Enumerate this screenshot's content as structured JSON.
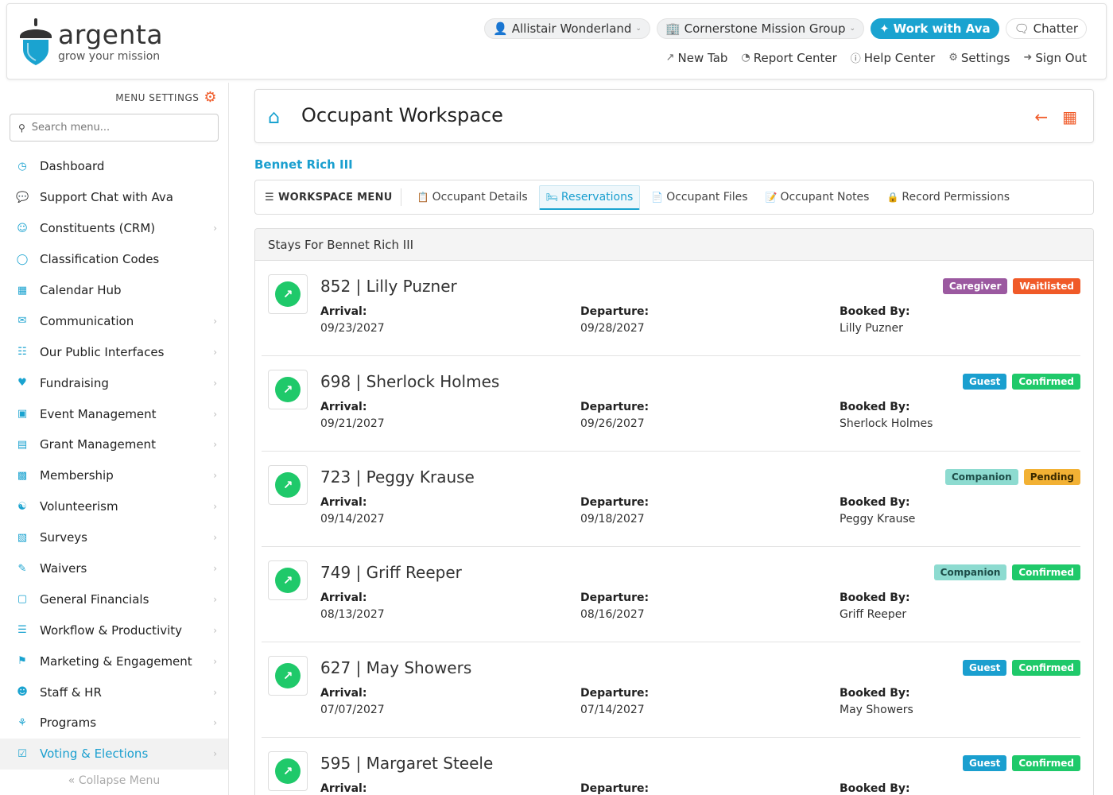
{
  "header": {
    "brand": "argenta",
    "tagline": "grow your mission",
    "user": "Allistair Wonderland",
    "org": "Cornerstone Mission Group",
    "ava_button": "Work with Ava",
    "chatter": "Chatter",
    "links": [
      {
        "label": "New Tab",
        "icon": "external-link-icon"
      },
      {
        "label": "Report Center",
        "icon": "chart-icon"
      },
      {
        "label": "Help Center",
        "icon": "help-icon"
      },
      {
        "label": "Settings",
        "icon": "gear-icon"
      },
      {
        "label": "Sign Out",
        "icon": "sign-out-icon"
      }
    ]
  },
  "sidebar": {
    "menu_settings": "MENU SETTINGS",
    "search_placeholder": "Search menu...",
    "items": [
      {
        "label": "Dashboard",
        "icon": "dashboard-icon"
      },
      {
        "label": "Support Chat with Ava",
        "icon": "chat-icon"
      },
      {
        "label": "Constituents (CRM)",
        "icon": "people-icon"
      },
      {
        "label": "Classification Codes",
        "icon": "tag-icon"
      },
      {
        "label": "Calendar Hub",
        "icon": "calendar-icon"
      },
      {
        "label": "Communication",
        "icon": "mail-icon"
      },
      {
        "label": "Our Public Interfaces",
        "icon": "globe-icon"
      },
      {
        "label": "Fundraising",
        "icon": "donation-icon"
      },
      {
        "label": "Event Management",
        "icon": "event-icon"
      },
      {
        "label": "Grant Management",
        "icon": "grant-icon"
      },
      {
        "label": "Membership",
        "icon": "id-card-icon"
      },
      {
        "label": "Volunteerism",
        "icon": "volunteer-icon"
      },
      {
        "label": "Surveys",
        "icon": "survey-icon"
      },
      {
        "label": "Waivers",
        "icon": "waiver-icon"
      },
      {
        "label": "General Financials",
        "icon": "money-icon"
      },
      {
        "label": "Workflow & Productivity",
        "icon": "list-icon"
      },
      {
        "label": "Marketing & Engagement",
        "icon": "megaphone-icon"
      },
      {
        "label": "Staff & HR",
        "icon": "staff-icon"
      },
      {
        "label": "Programs",
        "icon": "programs-icon"
      },
      {
        "label": "Voting & Elections",
        "icon": "vote-icon"
      }
    ],
    "collapse": "Collapse Menu"
  },
  "workspace": {
    "title": "Occupant Workspace",
    "occupant": "Bennet Rich III",
    "menu_label": "WORKSPACE MENU",
    "tabs": [
      "Occupant Details",
      "Reservations",
      "Occupant Files",
      "Occupant Notes",
      "Record Permissions"
    ],
    "active_tab": "Reservations"
  },
  "stays": {
    "heading": "Stays For Bennet Rich III",
    "field_labels": {
      "arrival": "Arrival:",
      "departure": "Departure:",
      "booked_by": "Booked By:"
    },
    "colors": {
      "Caregiver": "#9b59a0",
      "Waitlisted": "#f05a28",
      "Guest": "#1a9fcf",
      "Confirmed": "#1fc96a",
      "Companion": "#8ddbd0",
      "Pending": "#f2b134"
    },
    "items": [
      {
        "title": "852 | Lilly Puzner",
        "arrival": "09/23/2027",
        "departure": "09/28/2027",
        "booked_by": "Lilly Puzner",
        "badges": [
          "Caregiver",
          "Waitlisted"
        ]
      },
      {
        "title": "698 | Sherlock Holmes",
        "arrival": "09/21/2027",
        "departure": "09/26/2027",
        "booked_by": "Sherlock Holmes",
        "badges": [
          "Guest",
          "Confirmed"
        ]
      },
      {
        "title": "723 | Peggy Krause",
        "arrival": "09/14/2027",
        "departure": "09/18/2027",
        "booked_by": "Peggy Krause",
        "badges": [
          "Companion",
          "Pending"
        ]
      },
      {
        "title": "749 | Griff Reeper",
        "arrival": "08/13/2027",
        "departure": "08/16/2027",
        "booked_by": "Griff Reeper",
        "badges": [
          "Companion",
          "Confirmed"
        ]
      },
      {
        "title": "627 | May Showers",
        "arrival": "07/07/2027",
        "departure": "07/14/2027",
        "booked_by": "May Showers",
        "badges": [
          "Guest",
          "Confirmed"
        ]
      },
      {
        "title": "595 | Margaret Steele",
        "arrival": "",
        "departure": "",
        "booked_by": "",
        "badges": [
          "Guest",
          "Confirmed"
        ]
      }
    ]
  }
}
